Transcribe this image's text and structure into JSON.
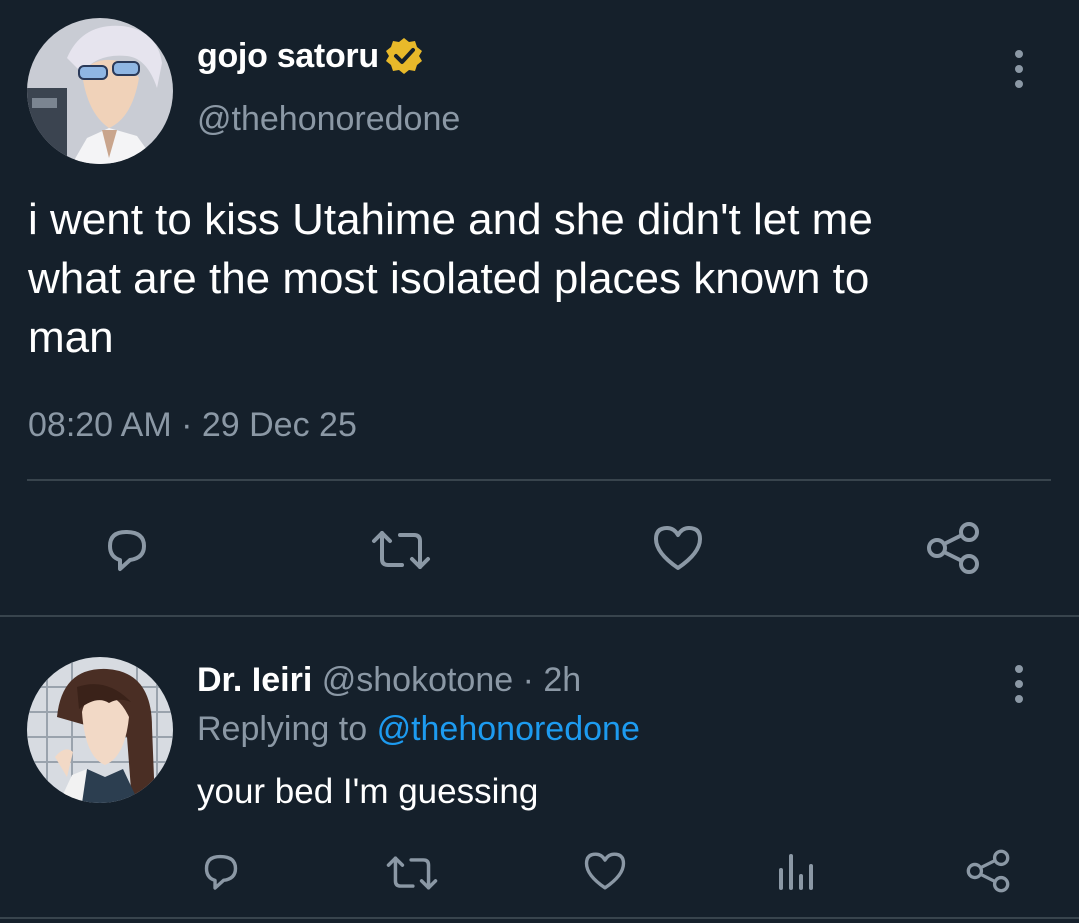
{
  "tweet": {
    "author_name": "gojo satoru",
    "handle": "@thehonoredone",
    "verified": true,
    "text_lines": [
      "i went to kiss Utahime and she didn't let me",
      "what are the most isolated places known to",
      "man"
    ],
    "timestamp": "08:20 AM · 29 Dec 25",
    "actions": [
      "reply-icon",
      "retweet-icon",
      "like-icon",
      "share-icon"
    ]
  },
  "reply": {
    "author_name": "Dr. Ieiri",
    "handle_time": "@shokotone · 2h",
    "replying_prefix": "Replying to",
    "replying_handle": "@thehonoredone",
    "text": "your bed I'm guessing",
    "actions": [
      "reply-icon",
      "retweet-icon",
      "like-icon",
      "analytics-icon",
      "share-icon"
    ]
  },
  "colors": {
    "background": "#15202b",
    "muted": "#8b98a5",
    "link": "#1d9bf0",
    "verified": "#e8b92a",
    "divider": "#38444d"
  }
}
